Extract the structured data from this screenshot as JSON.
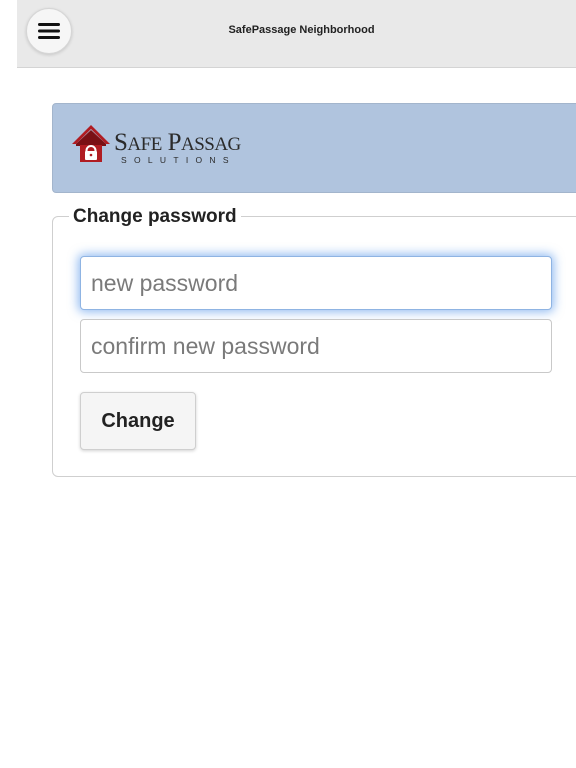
{
  "header": {
    "title": "SafePassage Neighborhood",
    "menu_icon": "hamburger-menu-icon"
  },
  "banner": {
    "logo": {
      "brand_main": "SafePassage",
      "brand_sub": "SOLUTIONS",
      "icon": "house-lock-icon",
      "colors": {
        "roof": "#b01c22",
        "text": "#2b2b2b"
      }
    },
    "background_color": "#b0c4de"
  },
  "form": {
    "legend": "Change password",
    "new_password": {
      "placeholder": "new password",
      "value": ""
    },
    "confirm_password": {
      "placeholder": "confirm new password",
      "value": ""
    },
    "submit_label": "Change",
    "focus_color": "#3884e6"
  }
}
